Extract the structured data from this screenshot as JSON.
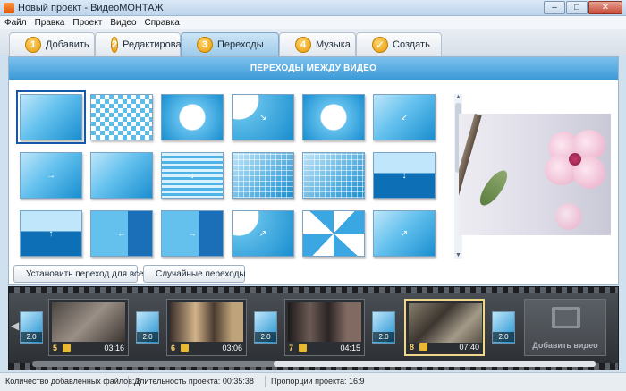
{
  "window": {
    "title": "Новый проект - ВидеоМОНТАЖ",
    "controls": {
      "minimize": "–",
      "maximize": "□",
      "close": "✕"
    }
  },
  "menu": [
    "Файл",
    "Правка",
    "Проект",
    "Видео",
    "Справка"
  ],
  "tabs": [
    {
      "num": "1",
      "label": "Добавить",
      "active": false
    },
    {
      "num": "2",
      "label": "Редактировать",
      "active": false
    },
    {
      "num": "3",
      "label": "Переходы",
      "active": true
    },
    {
      "num": "4",
      "label": "Музыка",
      "active": false
    },
    {
      "num": "✓",
      "label": "Создать",
      "active": false
    }
  ],
  "panel": {
    "header": "ПЕРЕХОДЫ МЕЖДУ ВИДЕО",
    "buttons": {
      "apply_all": "Установить переход для всех",
      "random": "Случайные переходы"
    }
  },
  "timeline": {
    "clips": [
      {
        "num": "5",
        "duration": "03:16",
        "selected": false
      },
      {
        "num": "6",
        "duration": "03:06",
        "selected": false
      },
      {
        "num": "7",
        "duration": "04:15",
        "selected": false
      },
      {
        "num": "8",
        "duration": "07:40",
        "selected": true
      }
    ],
    "transition_label": "2.0",
    "add_video": "Добавить видео"
  },
  "status": {
    "files_label": "Количество добавленных файлов:",
    "files_count": "8",
    "duration_label": "Длительность проекта:",
    "duration": "00:35:38",
    "ratio_label": "Пропорции проекта:",
    "ratio": "16:9"
  },
  "colors": {
    "header_blue": "#3b9ad7",
    "accent_orange": "#e69b07",
    "timeline_bg": "#2a2d31",
    "selected_clip": "#f0d88a"
  }
}
